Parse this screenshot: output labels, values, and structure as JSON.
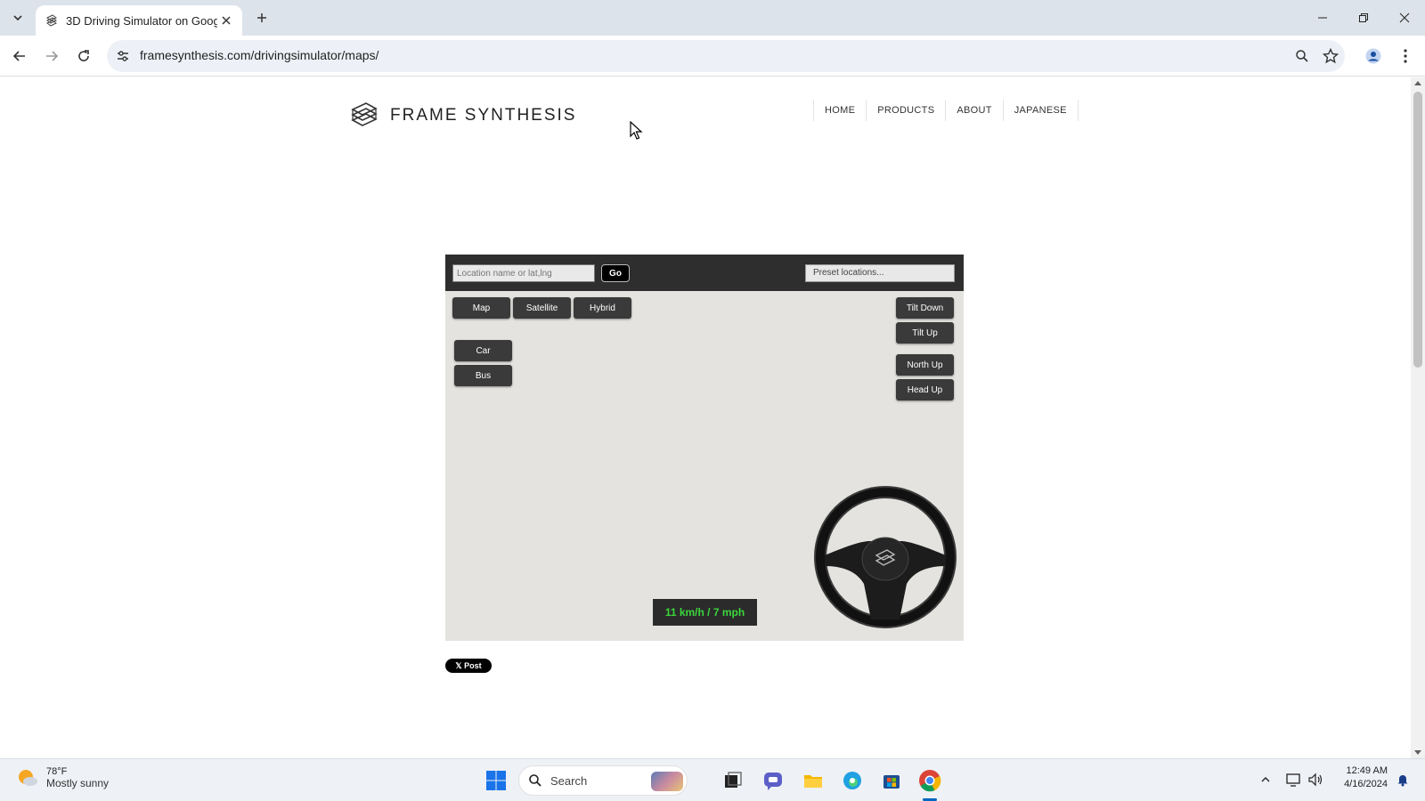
{
  "browser": {
    "tab_title": "3D Driving Simulator on Googl",
    "url": "framesynthesis.com/drivingsimulator/maps/"
  },
  "site": {
    "logo_text": "FRAME SYNTHESIS",
    "nav": [
      "HOME",
      "PRODUCTS",
      "ABOUT",
      "JAPANESE"
    ]
  },
  "simulator": {
    "location_placeholder": "Location name or lat,lng",
    "go_label": "Go",
    "preset_label": "Preset locations...",
    "map_types": [
      "Map",
      "Satellite",
      "Hybrid"
    ],
    "vehicles": [
      "Car",
      "Bus"
    ],
    "tilt_down": "Tilt Down",
    "tilt_up": "Tilt Up",
    "north_up": "North Up",
    "head_up": "Head Up",
    "speed": "11 km/h /   7 mph",
    "speed_color": "#3cd63c"
  },
  "social": {
    "post_label": "𝕏 Post"
  },
  "taskbar": {
    "weather_temp": "78°F",
    "weather_desc": "Mostly sunny",
    "search_label": "Search",
    "time": "12:49 AM",
    "date": "4/16/2024"
  }
}
